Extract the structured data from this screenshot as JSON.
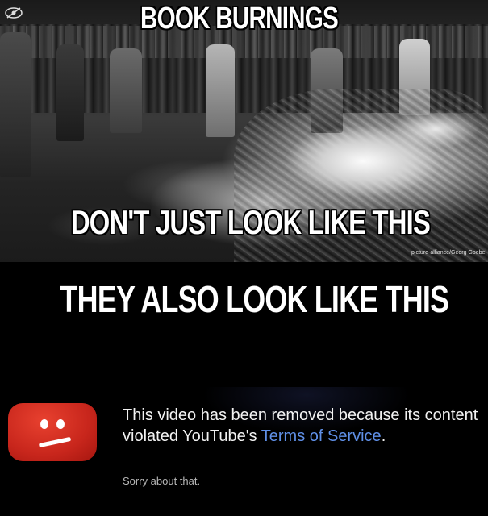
{
  "meme": {
    "top_caption": "BOOK BURNINGS",
    "middle_caption": "DON'T JUST LOOK LIKE THIS",
    "photo_credit": "picture-alliance/Georg Goebel",
    "bottom_caption": "THEY ALSO LOOK LIKE THIS"
  },
  "removed_notice": {
    "message": "This video has been removed because its content violated YouTube's",
    "link_text": "Terms of Service",
    "period": ".",
    "sorry": "Sorry about that.",
    "icon": "sad-face-icon",
    "icon_color": "#d9291d",
    "link_color": "#5f8fe6"
  }
}
